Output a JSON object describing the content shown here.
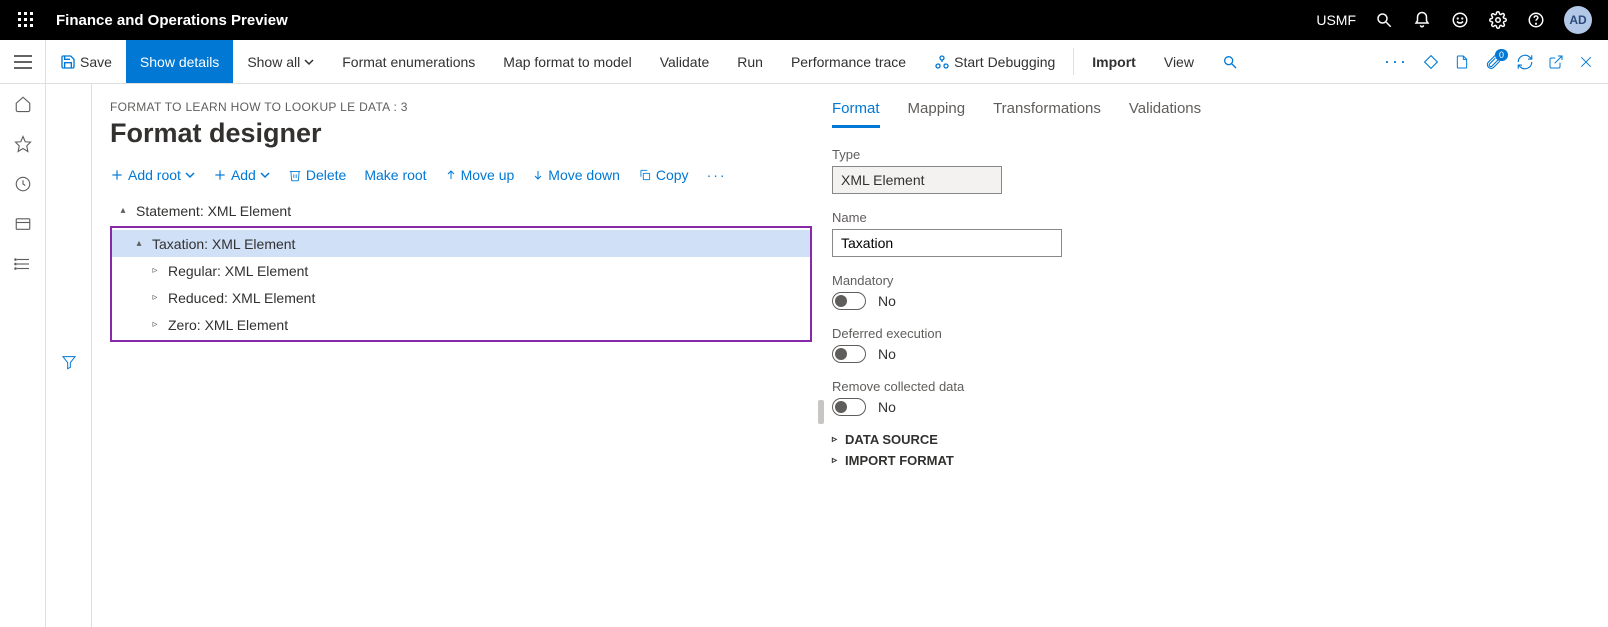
{
  "header": {
    "app_title": "Finance and Operations Preview",
    "company": "USMF",
    "avatar": "AD"
  },
  "actionbar": {
    "save": "Save",
    "show_details": "Show details",
    "show_all": "Show all",
    "format_enums": "Format enumerations",
    "map_format": "Map format to model",
    "validate": "Validate",
    "run": "Run",
    "perf_trace": "Performance trace",
    "start_debug": "Start Debugging",
    "import": "Import",
    "view": "View",
    "attach_count": "0"
  },
  "breadcrumb": "FORMAT TO LEARN HOW TO LOOKUP LE DATA : 3",
  "page_title": "Format designer",
  "tree_toolbar": {
    "add_root": "Add root",
    "add": "Add",
    "delete": "Delete",
    "make_root": "Make root",
    "move_up": "Move up",
    "move_down": "Move down",
    "copy": "Copy"
  },
  "tree": {
    "root": "Statement: XML Element",
    "taxation": "Taxation: XML Element",
    "regular": "Regular: XML Element",
    "reduced": "Reduced: XML Element",
    "zero": "Zero: XML Element"
  },
  "tabs": {
    "format": "Format",
    "mapping": "Mapping",
    "transformations": "Transformations",
    "validations": "Validations"
  },
  "props": {
    "type_label": "Type",
    "type_value": "XML Element",
    "name_label": "Name",
    "name_value": "Taxation",
    "mandatory_label": "Mandatory",
    "mandatory_value": "No",
    "deferred_label": "Deferred execution",
    "deferred_value": "No",
    "remove_label": "Remove collected data",
    "remove_value": "No",
    "data_source": "DATA SOURCE",
    "import_format": "IMPORT FORMAT"
  }
}
